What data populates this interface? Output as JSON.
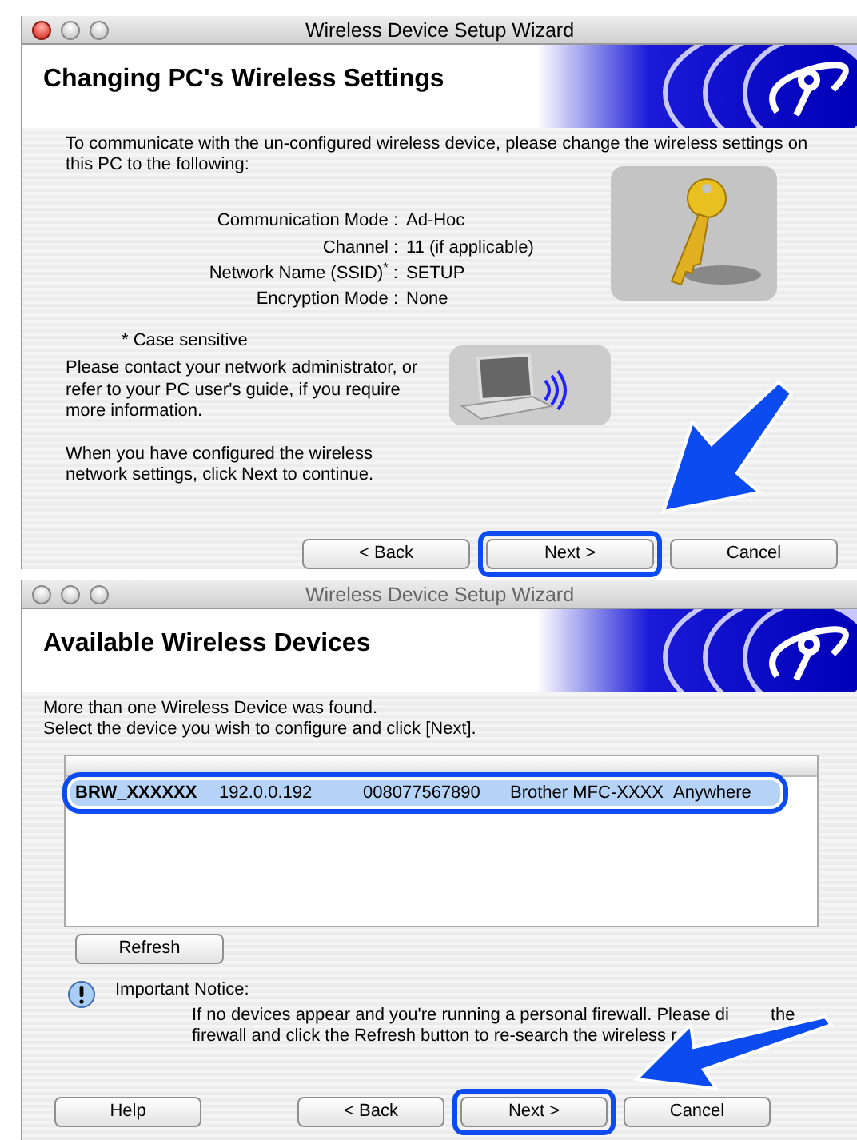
{
  "windows": [
    {
      "kind": "settings",
      "title": "Wireless Device Setup Wizard",
      "active": true,
      "heading": "Changing PC's Wireless Settings",
      "intro": "To communicate with the un-configured wireless device, please change the wireless settings on this PC to the following:",
      "settings": [
        {
          "label": "Communication Mode :",
          "value": "Ad-Hoc"
        },
        {
          "label": "Channel :",
          "value": "11  (if applicable)"
        },
        {
          "label": "Network Name (SSID)$^{*}$ :",
          "value": "SETUP"
        },
        {
          "label": "Encryption Mode :",
          "value": "None"
        }
      ],
      "footnote": "* Case sensitive",
      "contact_text": "Please contact your network administrator, or refer to your PC user's guide, if you require more information.",
      "next_text": "When you have configured the wireless network settings, click Next to continue.",
      "buttons": [
        {
          "label": "< Back",
          "highlighted": false
        },
        {
          "label": "Next >",
          "highlighted": true
        },
        {
          "label": "Cancel",
          "highlighted": false
        }
      ]
    },
    {
      "kind": "devices",
      "title": "Wireless Device Setup Wizard",
      "active": false,
      "heading": "Available Wireless Devices",
      "message_lines": [
        "More than one Wireless Device was found.",
        "Select the device you wish to configure and click [Next]."
      ],
      "table": {
        "rows": [
          {
            "cells": [
              "BRW_XXXXXX",
              "192.0.0.192",
              "008077567890",
              "Brother MFC-XXXX",
              "Anywhere"
            ],
            "selected": true,
            "highlighted": true
          }
        ]
      },
      "refresh_button": "Refresh",
      "notice": {
        "title": "Important Notice:",
        "line_1": "If no devices appear and you're running a personal firewall. Please di",
        "line_1_end": "the",
        "line_2": "firewall and click the Refresh button to re-search the wireless r"
      },
      "buttons": [
        {
          "label": "Help",
          "highlighted": false
        },
        {
          "label": "< Back",
          "highlighted": false
        },
        {
          "label": "Next >",
          "highlighted": true
        },
        {
          "label": "Cancel",
          "highlighted": false
        }
      ]
    }
  ]
}
